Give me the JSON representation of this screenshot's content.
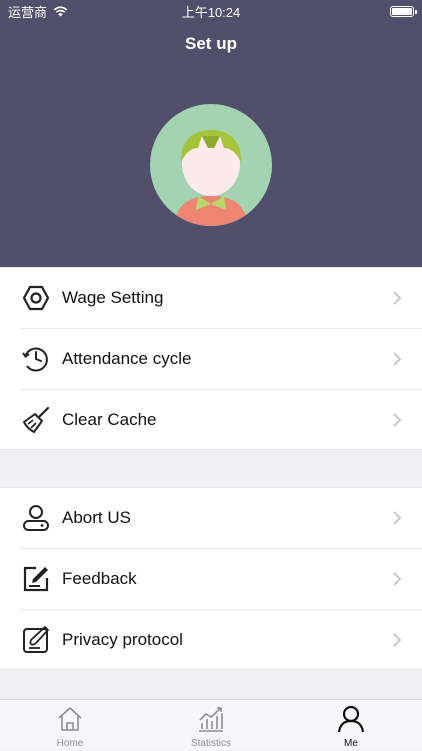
{
  "status_bar": {
    "carrier": "运营商",
    "time": "上午10:24"
  },
  "nav": {
    "title": "Set up"
  },
  "colors": {
    "header_bg": "#514f6b",
    "avatar_bg": "#a3d3b0",
    "hair": "#a5c43a",
    "shirt": "#ef8473",
    "bowtie": "#b7d86a"
  },
  "groups": [
    {
      "items": [
        {
          "icon": "hexagon-nut-icon",
          "label": "Wage Setting"
        },
        {
          "icon": "clock-cycle-icon",
          "label": "Attendance cycle"
        },
        {
          "icon": "broom-icon",
          "label": "Clear Cache"
        }
      ]
    },
    {
      "items": [
        {
          "icon": "user-icon",
          "label": "Abort US"
        },
        {
          "icon": "edit-icon",
          "label": "Feedback"
        },
        {
          "icon": "pen-document-icon",
          "label": "Privacy protocol"
        }
      ]
    }
  ],
  "tabs": [
    {
      "icon": "home-icon",
      "label": "Home",
      "active": false
    },
    {
      "icon": "statistics-icon",
      "label": "Statistics",
      "active": false
    },
    {
      "icon": "person-icon",
      "label": "Me",
      "active": true
    }
  ]
}
